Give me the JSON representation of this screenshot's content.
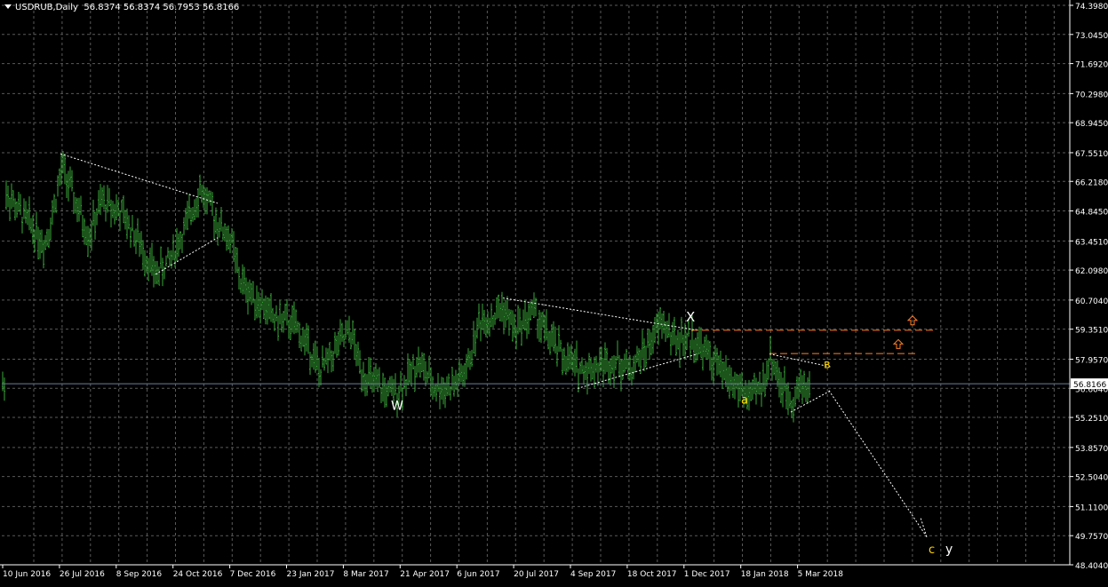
{
  "header": {
    "symbol_period": "USDRUB,Daily",
    "ohlc": "56.8374 56.8374 56.7953 56.8166"
  },
  "colors": {
    "background": "#000000",
    "grid": "#5a5a5a",
    "candle": "#39a839",
    "axis": "#ffffff",
    "price_line": "#6b7f99",
    "wave_white": "#ffffff",
    "wave_yellow": "#ffd600",
    "level": "#ff7f27"
  },
  "price_axis": {
    "labels": [
      "74.3980",
      "73.0450",
      "71.6920",
      "70.2980",
      "68.9450",
      "67.5510",
      "66.2180",
      "64.8450",
      "63.4510",
      "62.0980",
      "60.7040",
      "59.3510",
      "57.9570",
      "56.6040",
      "55.2510",
      "53.8570",
      "52.5040",
      "51.1100",
      "49.7570",
      "48.4040"
    ],
    "current_price": "56.8166"
  },
  "time_axis": {
    "labels": [
      "10 Jun 2016",
      "26 Jul 2016",
      "8 Sep 2016",
      "24 Oct 2016",
      "7 Dec 2016",
      "23 Jan 2017",
      "8 Mar 2017",
      "21 Apr 2017",
      "6 Jun 2017",
      "20 Jul 2017",
      "4 Sep 2017",
      "18 Oct 2017",
      "1 Dec 2017",
      "18 Jan 2018",
      "5 Mar 2018"
    ]
  },
  "wave_labels": {
    "w": "W",
    "x": "X",
    "y": "y",
    "a": "a",
    "b": "в",
    "c": "c"
  },
  "chart_data": {
    "type": "bar",
    "title": "USDRUB,Daily",
    "x": [
      "10 Jun 2016",
      "26 Jul 2016",
      "8 Sep 2016",
      "24 Oct 2016",
      "7 Dec 2016",
      "23 Jan 2017",
      "8 Mar 2017",
      "21 Apr 2017",
      "6 Jun 2017",
      "20 Jul 2017",
      "4 Sep 2017",
      "18 Oct 2017",
      "1 Dec 2017",
      "18 Jan 2018",
      "5 Mar 2018"
    ],
    "series": [
      {
        "values": [
          65.3,
          66.8,
          64.6,
          63.6,
          64.3,
          61.2,
          59.7,
          57.2,
          56.6,
          59.2,
          59.4,
          58.0,
          58.2,
          56.5,
          56.8
        ]
      }
    ],
    "ylim": [
      48.404,
      74.398
    ],
    "grid": true,
    "last_close": 56.8166
  }
}
